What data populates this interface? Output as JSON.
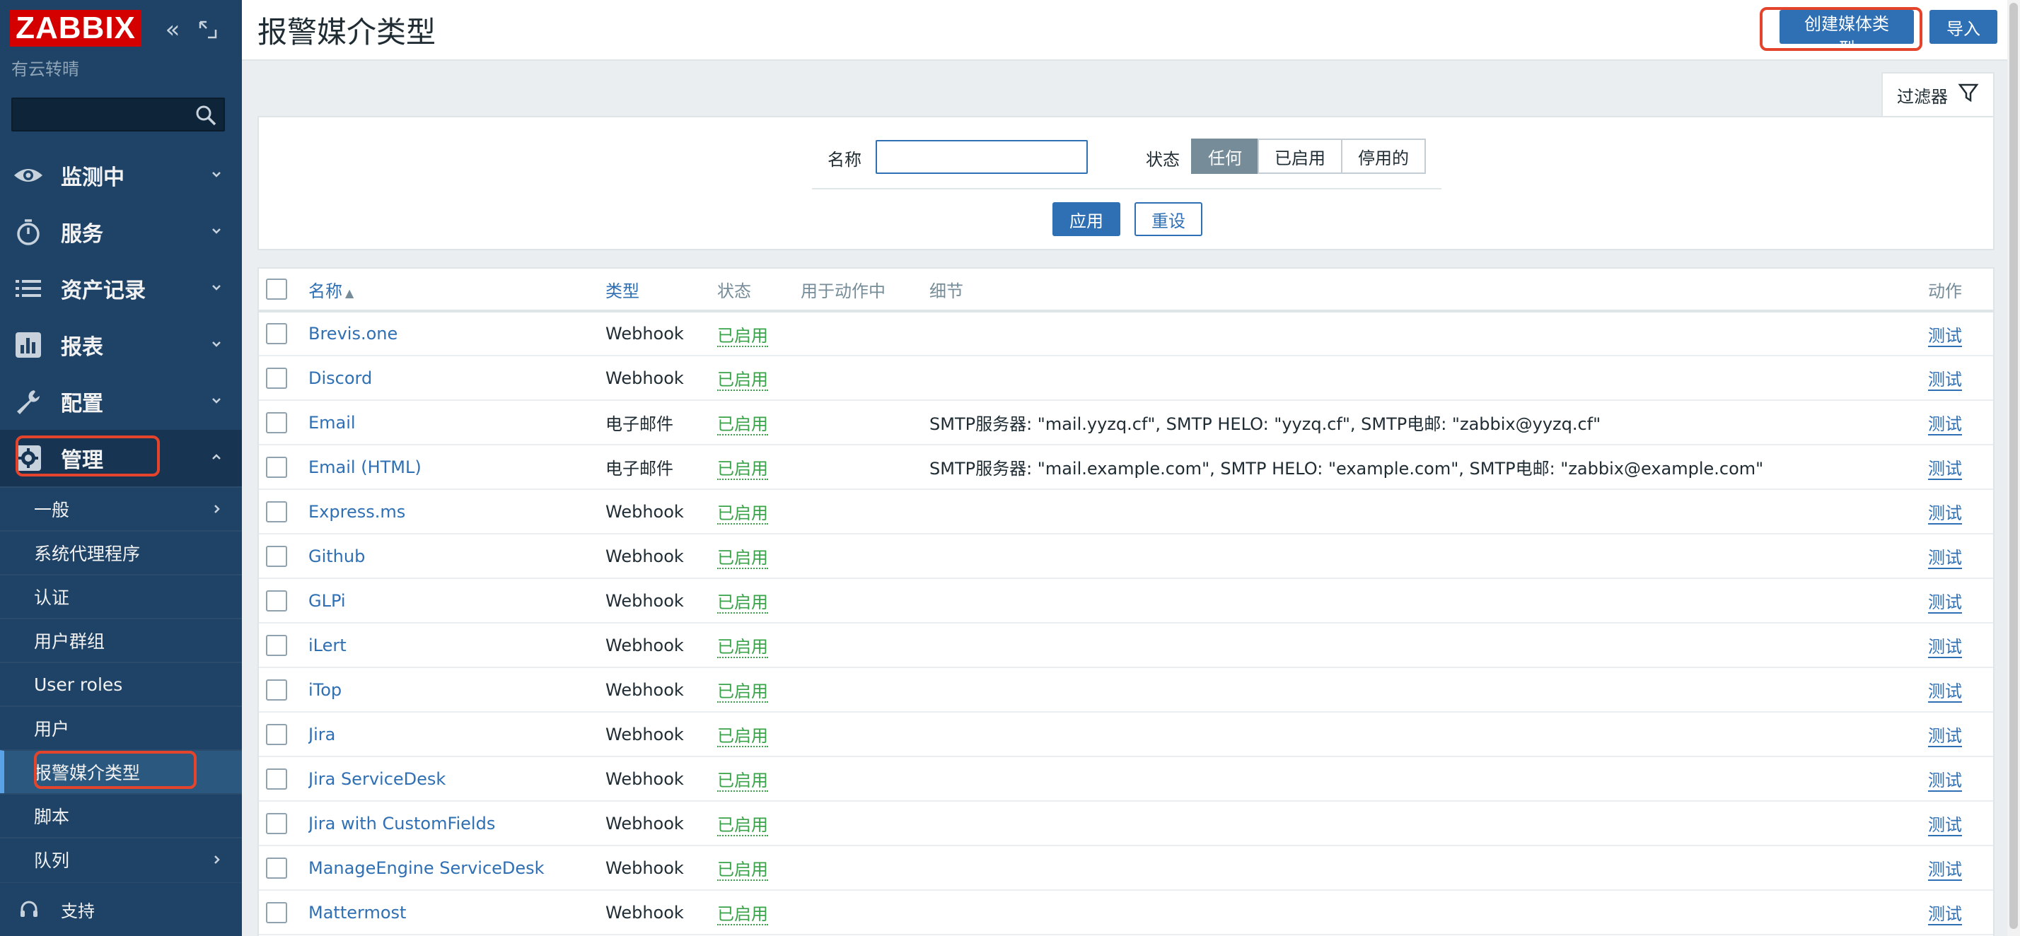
{
  "sidebar": {
    "logo": "ZABBIX",
    "server_name": "有云转晴",
    "search_placeholder": "",
    "menu": [
      {
        "label": "监测中",
        "icon": "eye-icon"
      },
      {
        "label": "服务",
        "icon": "stopwatch-icon"
      },
      {
        "label": "资产记录",
        "icon": "list-icon"
      },
      {
        "label": "报表",
        "icon": "bar-chart-icon"
      },
      {
        "label": "配置",
        "icon": "wrench-icon"
      },
      {
        "label": "管理",
        "icon": "gear-icon"
      }
    ],
    "admin_submenu": [
      {
        "label": "一般",
        "has_children": true
      },
      {
        "label": "系统代理程序",
        "has_children": false
      },
      {
        "label": "认证",
        "has_children": false
      },
      {
        "label": "用户群组",
        "has_children": false
      },
      {
        "label": "User roles",
        "has_children": false
      },
      {
        "label": "用户",
        "has_children": false
      },
      {
        "label": "报警媒介类型",
        "has_children": false
      },
      {
        "label": "脚本",
        "has_children": false
      },
      {
        "label": "队列",
        "has_children": true
      }
    ],
    "support_label": "支持"
  },
  "header": {
    "title": "报警媒介类型",
    "create_label": "创建媒体类型",
    "import_label": "导入"
  },
  "filter": {
    "tab_label": "过滤器",
    "name_label": "名称",
    "name_value": "",
    "state_label": "状态",
    "state_options": [
      "任何",
      "已启用",
      "停用的"
    ],
    "state_selected": "任何",
    "apply_label": "应用",
    "reset_label": "重设"
  },
  "table": {
    "columns": {
      "name": "名称",
      "type": "类型",
      "status": "状态",
      "used_in_actions": "用于动作中",
      "details": "细节",
      "actions": "动作"
    },
    "rows": [
      {
        "name": "Brevis.one",
        "type": "Webhook",
        "status": "已启用",
        "details": "",
        "action": "测试"
      },
      {
        "name": "Discord",
        "type": "Webhook",
        "status": "已启用",
        "details": "",
        "action": "测试"
      },
      {
        "name": "Email",
        "type": "电子邮件",
        "status": "已启用",
        "details": "SMTP服务器: \"mail.yyzq.cf\", SMTP HELO: \"yyzq.cf\", SMTP电邮: \"zabbix@yyzq.cf\"",
        "action": "测试"
      },
      {
        "name": "Email (HTML)",
        "type": "电子邮件",
        "status": "已启用",
        "details": "SMTP服务器: \"mail.example.com\", SMTP HELO: \"example.com\", SMTP电邮: \"zabbix@example.com\"",
        "action": "测试"
      },
      {
        "name": "Express.ms",
        "type": "Webhook",
        "status": "已启用",
        "details": "",
        "action": "测试"
      },
      {
        "name": "Github",
        "type": "Webhook",
        "status": "已启用",
        "details": "",
        "action": "测试"
      },
      {
        "name": "GLPi",
        "type": "Webhook",
        "status": "已启用",
        "details": "",
        "action": "测试"
      },
      {
        "name": "iLert",
        "type": "Webhook",
        "status": "已启用",
        "details": "",
        "action": "测试"
      },
      {
        "name": "iTop",
        "type": "Webhook",
        "status": "已启用",
        "details": "",
        "action": "测试"
      },
      {
        "name": "Jira",
        "type": "Webhook",
        "status": "已启用",
        "details": "",
        "action": "测试"
      },
      {
        "name": "Jira ServiceDesk",
        "type": "Webhook",
        "status": "已启用",
        "details": "",
        "action": "测试"
      },
      {
        "name": "Jira with CustomFields",
        "type": "Webhook",
        "status": "已启用",
        "details": "",
        "action": "测试"
      },
      {
        "name": "ManageEngine ServiceDesk",
        "type": "Webhook",
        "status": "已启用",
        "details": "",
        "action": "测试"
      },
      {
        "name": "Mattermost",
        "type": "Webhook",
        "status": "已启用",
        "details": "",
        "action": "测试"
      }
    ]
  },
  "colors": {
    "sidebar_bg": "#1f4367",
    "primary": "#2f6fb3",
    "enabled": "#3aa34a",
    "logo_red": "#d40000",
    "highlight": "#e4442b"
  }
}
